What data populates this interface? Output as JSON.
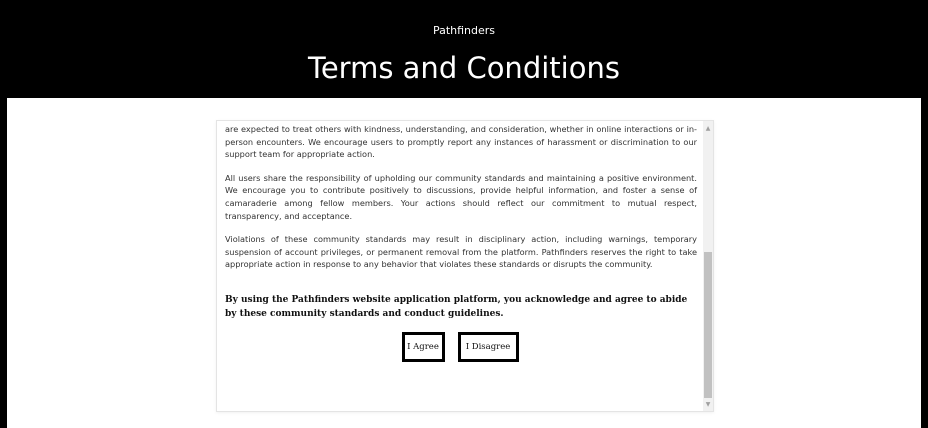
{
  "header": {
    "site_name": "Pathfinders",
    "title": "Terms and Conditions"
  },
  "terms": {
    "paragraphs": [
      "are expected to treat others with kindness, understanding, and consideration, whether in online interactions or in-person encounters. We encourage users to promptly report any instances of harassment or discrimination to our support team for appropriate action.",
      "All users share the responsibility of upholding our community standards and maintaining a positive environment. We encourage you to contribute positively to discussions, provide helpful information, and foster a sense of camaraderie among fellow members. Your actions should reflect our commitment to mutual respect, transparency, and acceptance.",
      "Violations of these community standards may result in disciplinary action, including warnings, temporary suspension of account privileges, or permanent removal from the platform. Pathfinders reserves the right to take appropriate action in response to any behavior that violates these standards or disrupts the community."
    ],
    "agreement": "By using the Pathfinders website application platform, you acknowledge and agree to abide by these community standards and conduct guidelines."
  },
  "buttons": {
    "agree_label": "I Agree",
    "disagree_label": "I Disagree"
  },
  "scrollbar": {
    "up_icon": "triangle-up-icon",
    "down_icon": "triangle-down-icon",
    "scroll_position": 0.98
  },
  "colors": {
    "header_bg": "#000000",
    "header_text": "#ffffff",
    "button_border": "#000000"
  }
}
